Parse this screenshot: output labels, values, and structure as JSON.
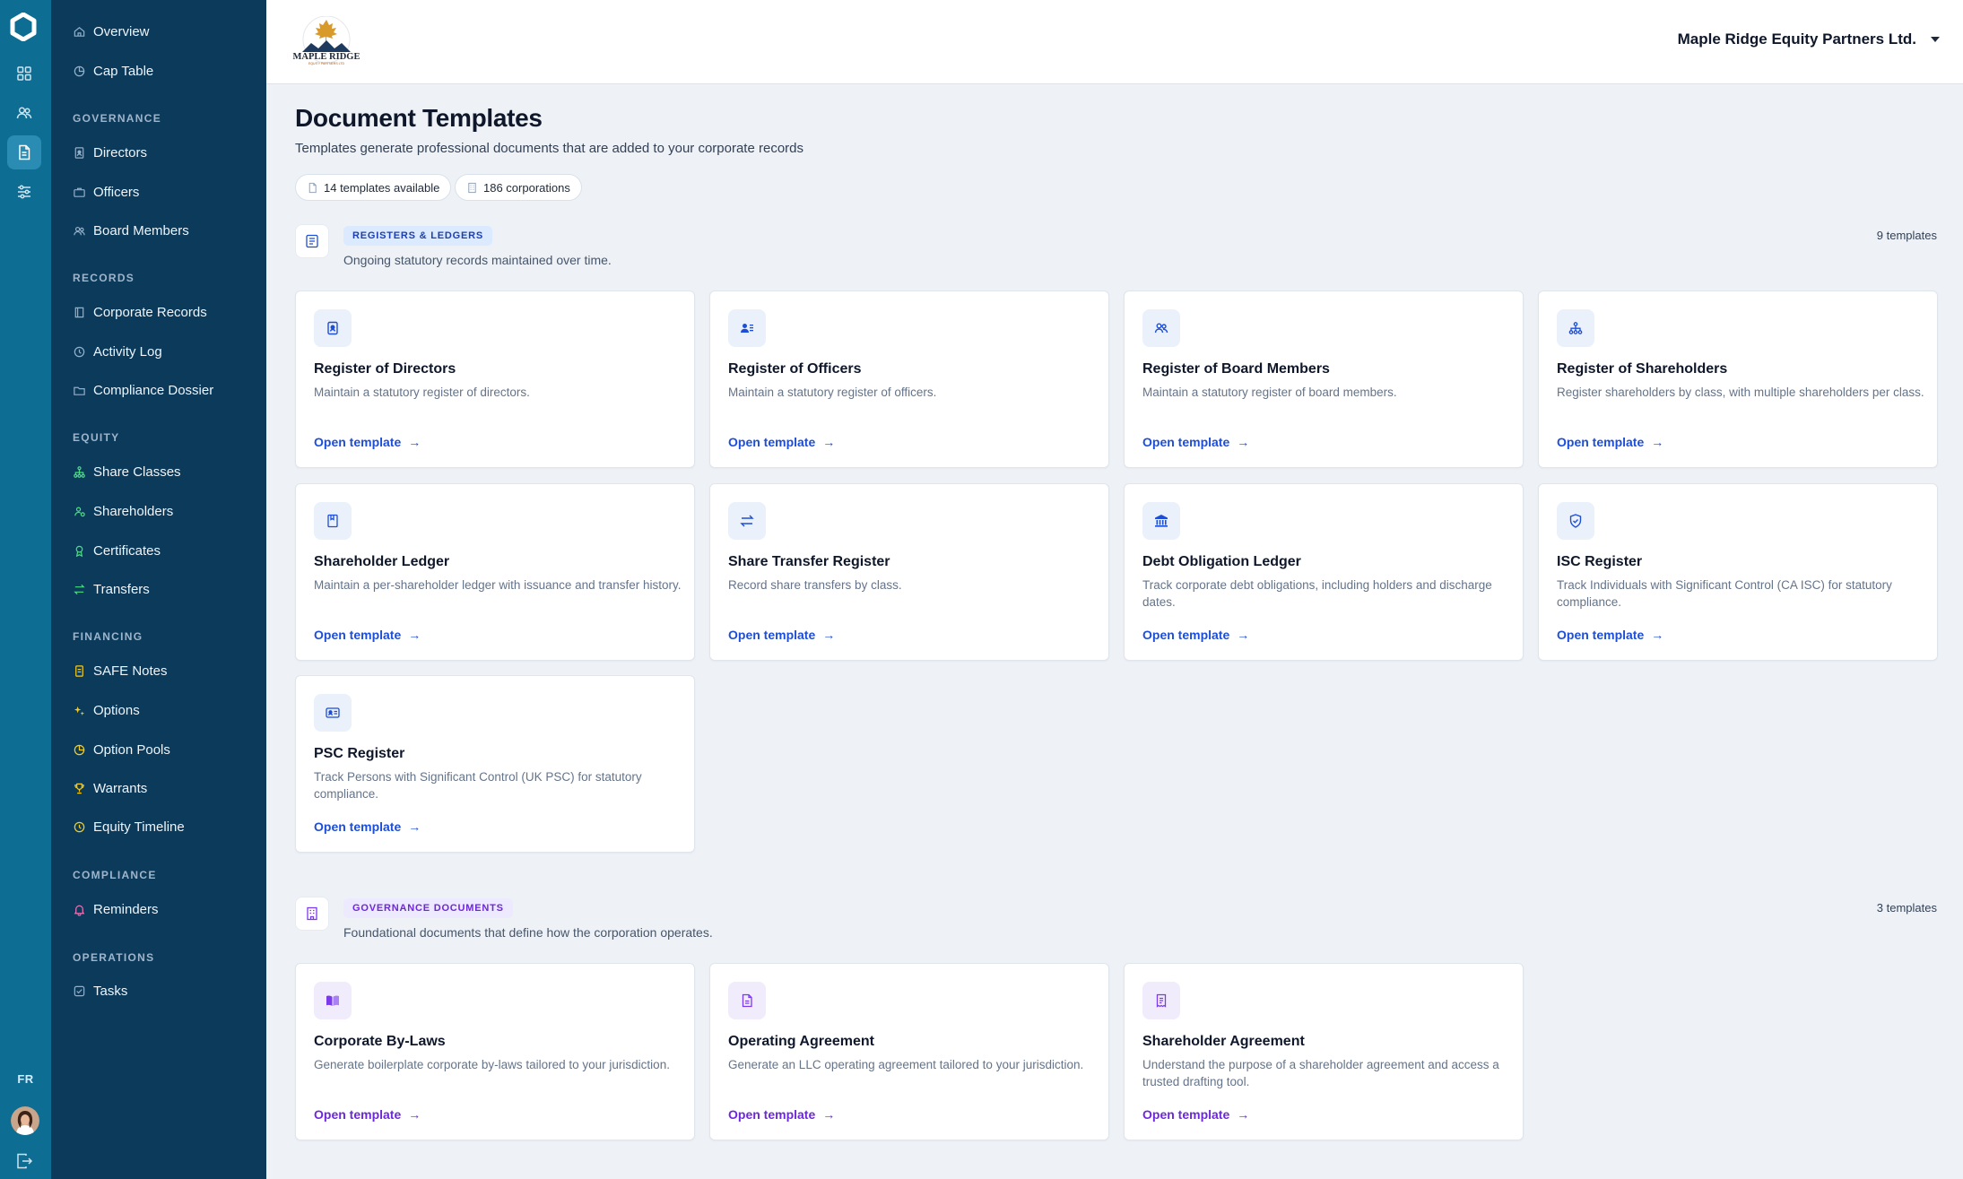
{
  "rail": {
    "language": "FR",
    "icons": [
      "grid-icon",
      "people-icon",
      "document-icon",
      "sliders-icon"
    ]
  },
  "nav": {
    "top": [
      {
        "label": "Overview",
        "icon": "home-icon"
      },
      {
        "label": "Cap Table",
        "icon": "pie-chart-icon"
      }
    ],
    "sections": [
      {
        "title": "GOVERNANCE",
        "items": [
          {
            "label": "Directors",
            "icon": "badge-icon"
          },
          {
            "label": "Officers",
            "icon": "briefcase-icon"
          },
          {
            "label": "Board Members",
            "icon": "people-icon"
          }
        ]
      },
      {
        "title": "RECORDS",
        "items": [
          {
            "label": "Corporate Records",
            "icon": "book-icon"
          },
          {
            "label": "Activity Log",
            "icon": "clock-icon"
          },
          {
            "label": "Compliance Dossier",
            "icon": "folder-icon"
          }
        ]
      },
      {
        "title": "EQUITY",
        "items": [
          {
            "label": "Share Classes",
            "icon": "hierarchy-icon"
          },
          {
            "label": "Shareholders",
            "icon": "shareholders-icon"
          },
          {
            "label": "Certificates",
            "icon": "award-icon"
          },
          {
            "label": "Transfers",
            "icon": "transfer-icon"
          }
        ]
      },
      {
        "title": "FINANCING",
        "items": [
          {
            "label": "SAFE Notes",
            "icon": "note-icon"
          },
          {
            "label": "Options",
            "icon": "sparkle-icon"
          },
          {
            "label": "Option Pools",
            "icon": "pie-chart-icon"
          },
          {
            "label": "Warrants",
            "icon": "trophy-icon"
          },
          {
            "label": "Equity Timeline",
            "icon": "clock-icon"
          }
        ]
      },
      {
        "title": "COMPLIANCE",
        "items": [
          {
            "label": "Reminders",
            "icon": "bell-icon"
          }
        ]
      },
      {
        "title": "OPERATIONS",
        "items": [
          {
            "label": "Tasks",
            "icon": "checkbox-icon"
          }
        ]
      }
    ]
  },
  "header": {
    "logo_text": "MAPLE RIDGE",
    "logo_subtext": "EQUITY PARTNERS LTD",
    "org_name": "Maple Ridge Equity Partners Ltd."
  },
  "page": {
    "title": "Document Templates",
    "subtitle": "Templates generate professional documents that are added to your corporate records",
    "chips": {
      "templates": "14 templates available",
      "corporations": "186 corporations"
    }
  },
  "sections": [
    {
      "badge": "REGISTERS & LEDGERS",
      "description": "Ongoing statutory records maintained over time.",
      "count": "9 templates",
      "color": "#1d4ed8",
      "cards": [
        {
          "title": "Register of Directors",
          "desc": "Maintain a statutory register of directors.",
          "link": "Open template",
          "icon": "id-badge-icon"
        },
        {
          "title": "Register of Officers",
          "desc": "Maintain a statutory register of officers.",
          "link": "Open template",
          "icon": "person-list-icon"
        },
        {
          "title": "Register of Board Members",
          "desc": "Maintain a statutory register of board members.",
          "link": "Open template",
          "icon": "people-icon"
        },
        {
          "title": "Register of Shareholders",
          "desc": "Register shareholders by class, with multiple shareholders per class.",
          "link": "Open template",
          "icon": "hierarchy-icon"
        },
        {
          "title": "Shareholder Ledger",
          "desc": "Maintain a per-shareholder ledger with issuance and transfer history.",
          "link": "Open template",
          "icon": "ledger-icon"
        },
        {
          "title": "Share Transfer Register",
          "desc": "Record share transfers by class.",
          "link": "Open template",
          "icon": "transfer-icon"
        },
        {
          "title": "Debt Obligation Ledger",
          "desc": "Track corporate debt obligations, including holders and discharge dates.",
          "link": "Open template",
          "icon": "bank-icon"
        },
        {
          "title": "ISC Register",
          "desc": "Track Individuals with Significant Control (CA ISC) for statutory compliance.",
          "link": "Open template",
          "icon": "shield-icon"
        },
        {
          "title": "PSC Register",
          "desc": "Track Persons with Significant Control (UK PSC) for statutory compliance.",
          "link": "Open template",
          "icon": "id-card-icon"
        }
      ]
    },
    {
      "badge": "GOVERNANCE DOCUMENTS",
      "description": "Foundational documents that define how the corporation operates.",
      "count": "3 templates",
      "color": "#6d28d9",
      "cards": [
        {
          "title": "Corporate By-Laws",
          "desc": "Generate boilerplate corporate by-laws tailored to your jurisdiction.",
          "link": "Open template",
          "icon": "open-book-icon"
        },
        {
          "title": "Operating Agreement",
          "desc": "Generate an LLC operating agreement tailored to your jurisdiction.",
          "link": "Open template",
          "icon": "document-icon"
        },
        {
          "title": "Shareholder Agreement",
          "desc": "Understand the purpose of a shareholder agreement and access a trusted drafting tool.",
          "link": "Open template",
          "icon": "receipt-icon"
        }
      ]
    }
  ]
}
